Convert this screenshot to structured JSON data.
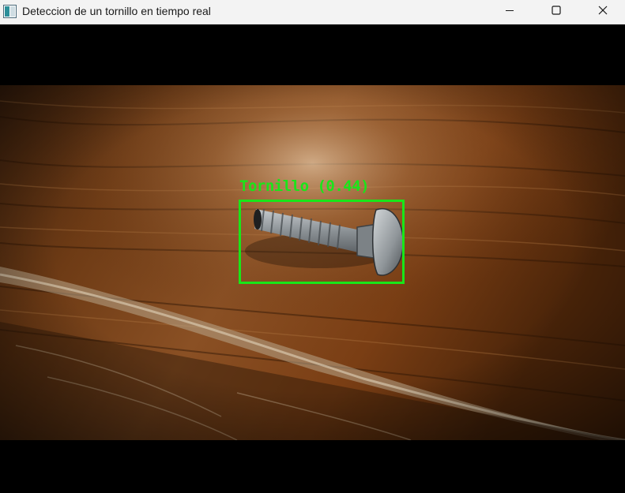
{
  "window": {
    "title": "Deteccion de un tornillo en tiempo real",
    "icon": "app-window-icon",
    "controls": {
      "minimize": "minimize-icon",
      "maximize": "maximize-icon",
      "close": "close-icon"
    }
  },
  "detection": {
    "label": "Tornillo (0.44)",
    "class_name": "Tornillo",
    "confidence": 0.44,
    "box_color": "#19e619"
  },
  "colors": {
    "letterbox": "#000000",
    "titlebar": "#f3f3f3"
  }
}
